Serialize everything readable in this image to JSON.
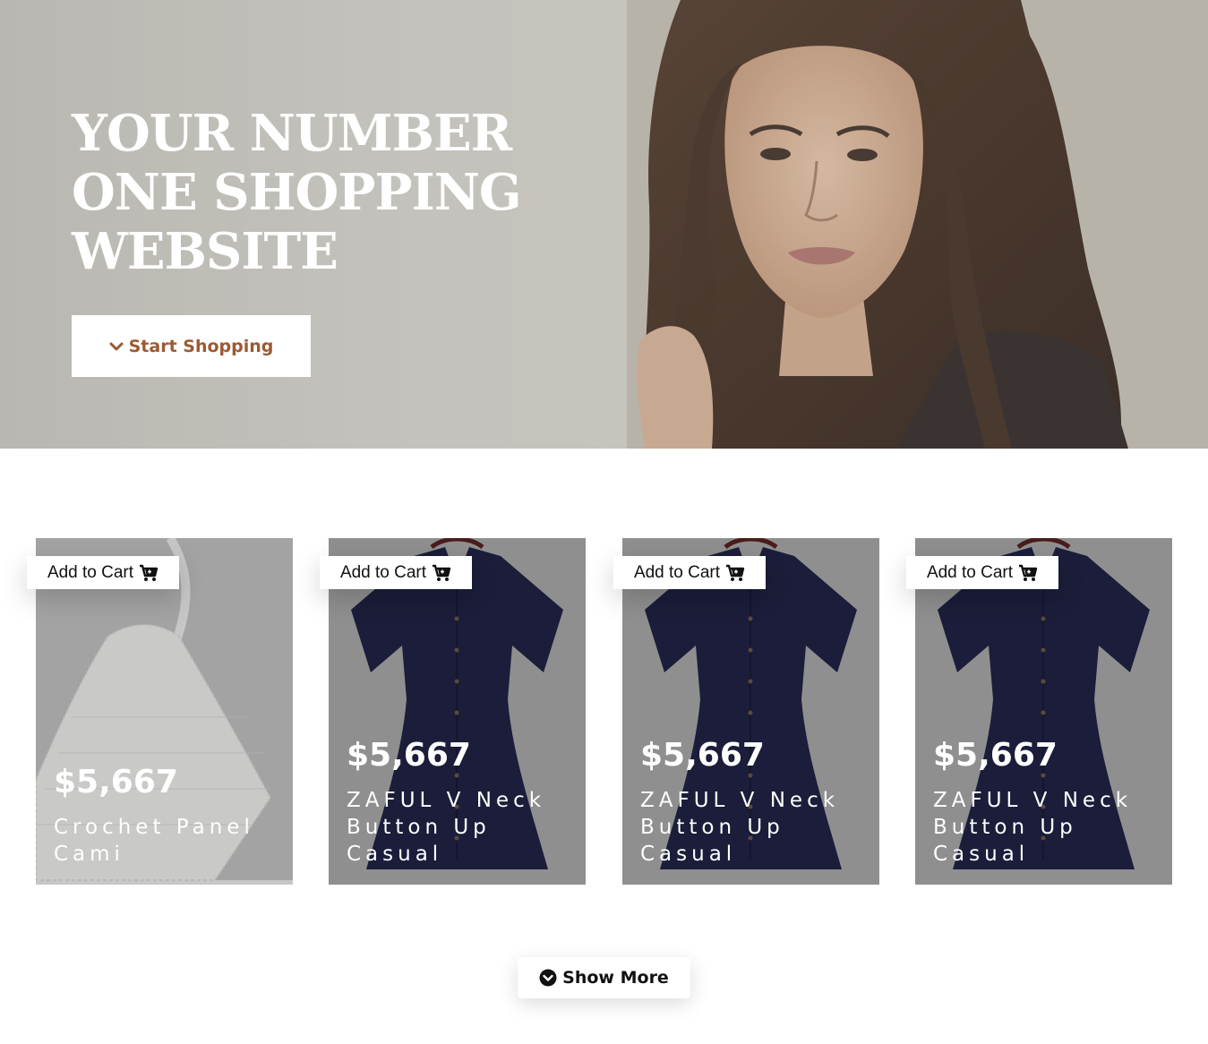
{
  "hero": {
    "title": "YOUR NUMBER ONE SHOPPING WEBSITE",
    "cta_label": "Start Shopping",
    "cta_icon": "chevron-down-icon",
    "cta_color": "#9a5a33"
  },
  "products": [
    {
      "cart_label": "Add to Cart",
      "price": "$5,667",
      "name": "Crochet Panel Cami",
      "image": "crochet-cami"
    },
    {
      "cart_label": "Add to Cart",
      "price": "$5,667",
      "name": "ZAFUL V Neck Button Up Casual",
      "image": "navy-dress"
    },
    {
      "cart_label": "Add to Cart",
      "price": "$5,667",
      "name": "ZAFUL V Neck Button Up Casual",
      "image": "navy-dress"
    },
    {
      "cart_label": "Add to Cart",
      "price": "$5,667",
      "name": "ZAFUL V Neck Button Up Casual",
      "image": "navy-dress"
    }
  ],
  "show_more": {
    "label": "Show More",
    "icon": "chevron-circle-down-icon"
  }
}
